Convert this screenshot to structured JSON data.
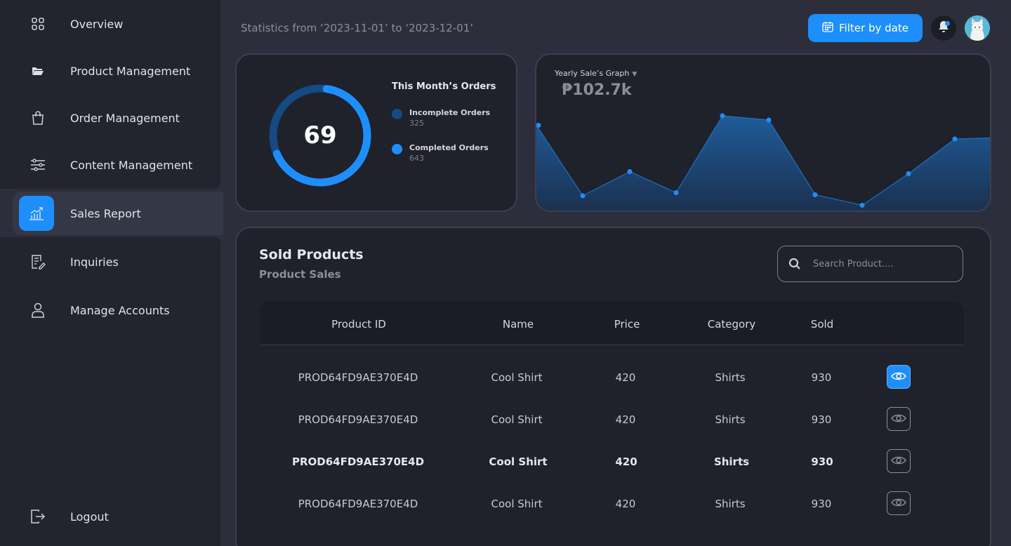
{
  "sidebar": {
    "items": [
      {
        "label": "Overview",
        "icon": "grid-icon"
      },
      {
        "label": "Product Management",
        "icon": "folder-icon"
      },
      {
        "label": "Order Management",
        "icon": "shopping-bag-icon"
      },
      {
        "label": "Content Management",
        "icon": "sliders-icon"
      },
      {
        "label": "Sales Report",
        "icon": "chart-icon",
        "active": true
      },
      {
        "label": "Inquiries",
        "icon": "document-edit-icon"
      },
      {
        "label": "Manage Accounts",
        "icon": "user-icon"
      }
    ],
    "logout_label": "Logout"
  },
  "header": {
    "stats_range": "Statistics from ‘2023-11-01’ to ‘2023-12-01’",
    "filter_label": "Filter by date"
  },
  "orders": {
    "title": "This Month’s Orders",
    "center_value": "69",
    "legend": [
      {
        "name": "Incomplete Orders",
        "value": "325",
        "color": "#154a82"
      },
      {
        "name": "Completed Orders",
        "value": "643",
        "color": "#1e8efc"
      }
    ]
  },
  "graph": {
    "title": "Yearly Sale’s Graph",
    "caret": "▼",
    "total": "₱102.7k"
  },
  "chart_data": {
    "type": "area",
    "title": "Yearly Sale’s Graph",
    "values": [
      79,
      12,
      35,
      15,
      88,
      84,
      13,
      3,
      33,
      66,
      67
    ]
  },
  "products": {
    "title": "Sold Products",
    "subtitle": "Product Sales",
    "search_placeholder": "Search Product....",
    "columns": [
      "Product ID",
      "Name",
      "Price",
      "Category",
      "Sold"
    ],
    "rows": [
      {
        "id": "PROD64FD9AE370E4D",
        "name": "Cool Shirt",
        "price": "420",
        "category": "Shirts",
        "sold": "930"
      },
      {
        "id": "PROD64FD9AE370E4D",
        "name": "Cool Shirt",
        "price": "420",
        "category": "Shirts",
        "sold": "930"
      },
      {
        "id": "PROD64FD9AE370E4D",
        "name": "Cool Shirt",
        "price": "420",
        "category": "Shirts",
        "sold": "930"
      },
      {
        "id": "PROD64FD9AE370E4D",
        "name": "Cool Shirt",
        "price": "420",
        "category": "Shirts",
        "sold": "930"
      }
    ]
  },
  "colors": {
    "accent": "#1e8efc",
    "accent_dark": "#154a82",
    "background": "#2c2f3b",
    "panel": "#1f212b"
  }
}
